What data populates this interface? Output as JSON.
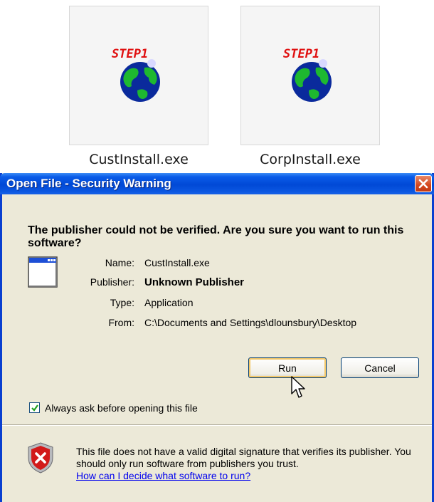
{
  "files": [
    {
      "name": "CustInstall.exe",
      "icon": "step1-globe-installer-icon"
    },
    {
      "name": "CorpInstall.exe",
      "icon": "step1-globe-installer-icon"
    }
  ],
  "dialog": {
    "title": "Open File - Security Warning",
    "headline": "The publisher could not be verified.  Are you sure you want to run this software?",
    "properties": [
      {
        "key": "Name:",
        "value": "CustInstall.exe"
      },
      {
        "key": "Publisher:",
        "value": "Unknown Publisher"
      },
      {
        "key": "Type:",
        "value": "Application"
      },
      {
        "key": "From:",
        "value": "C:\\Documents and Settings\\dlounsbury\\Desktop"
      }
    ],
    "run_label": "Run",
    "cancel_label": "Cancel",
    "checkbox_label": "Always ask before opening this file",
    "checkbox_checked": true,
    "warning_text": "This file does not have a valid digital signature that verifies its publisher.  You should only run software from publishers you trust.",
    "warning_link": "How can I decide what software to run?"
  },
  "colors": {
    "titlebar": "#0149d6",
    "dialog_bg": "#ece9d8",
    "close_button": "#d4471e",
    "link": "#0000ee"
  }
}
